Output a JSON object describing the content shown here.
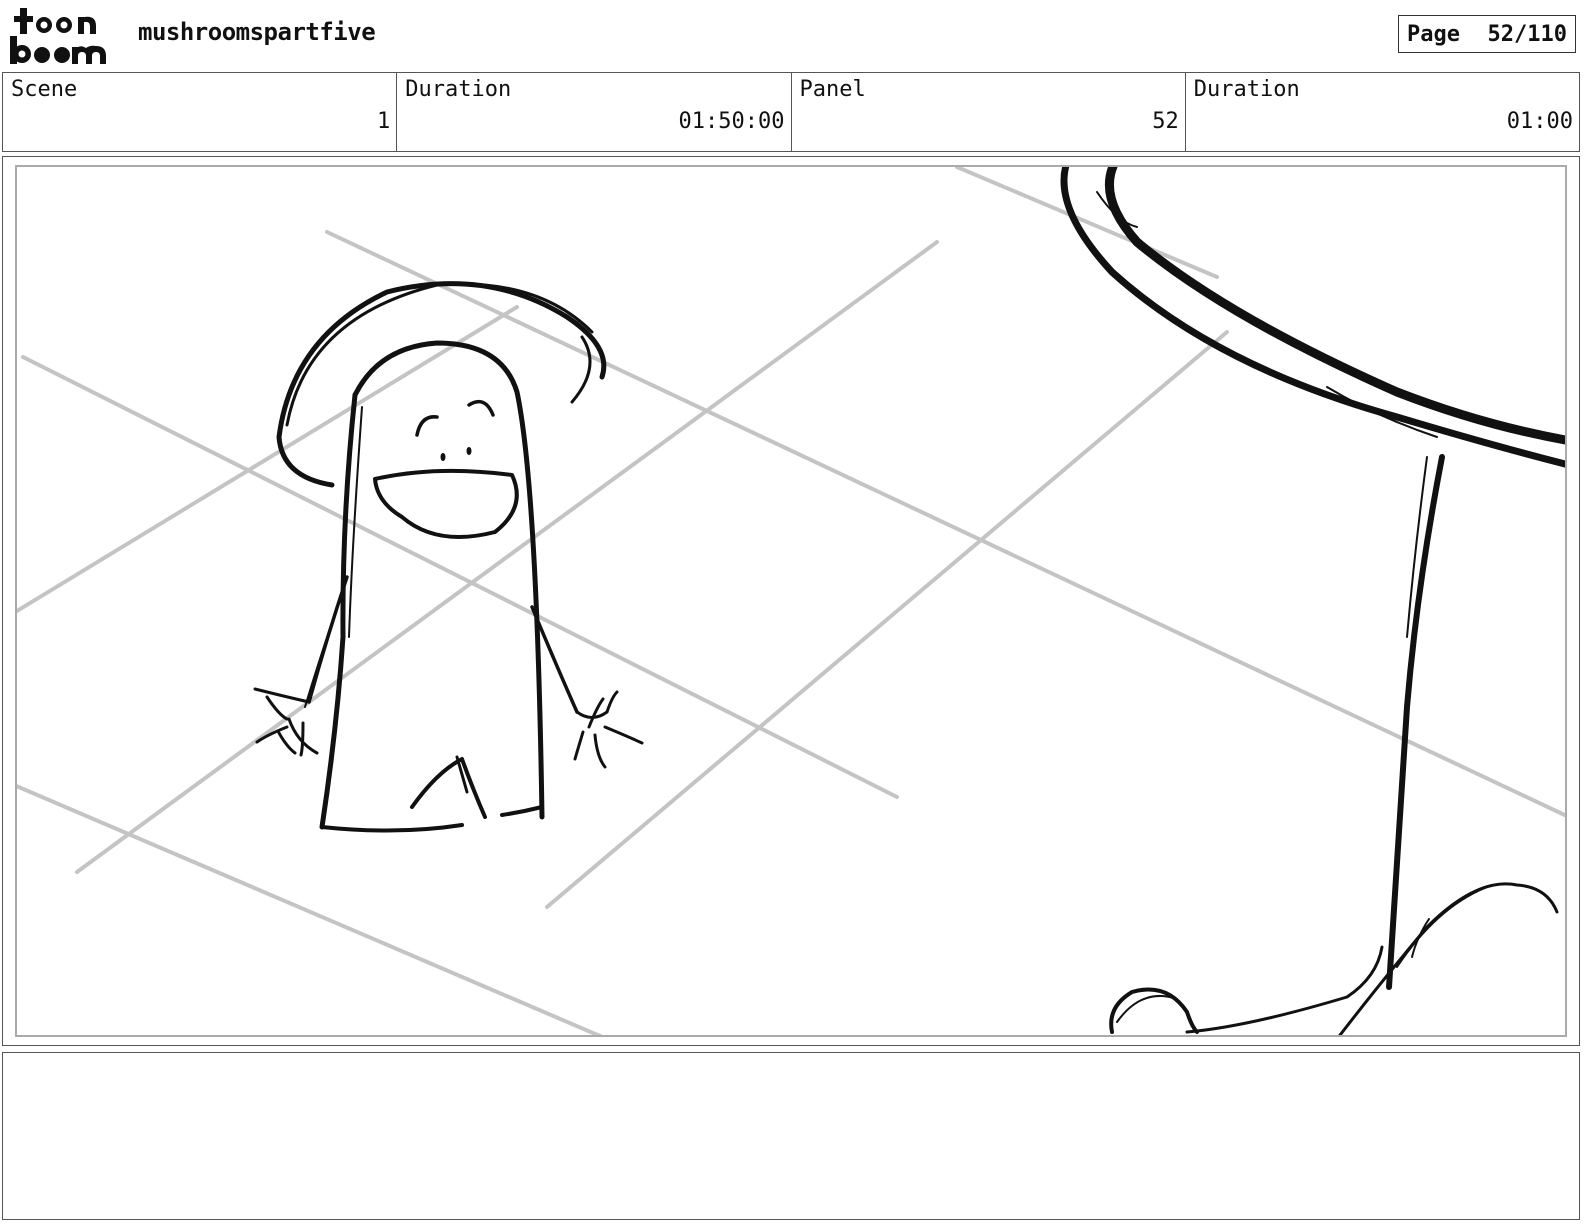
{
  "header": {
    "logo_text": "toon boom",
    "project_title": "mushroomspartfive",
    "page_label": "Page",
    "page_number": "52/110"
  },
  "info": {
    "scene_label": "Scene",
    "scene_value": "1",
    "scene_duration_label": "Duration",
    "scene_duration_value": "01:50:00",
    "panel_label": "Panel",
    "panel_value": "52",
    "panel_duration_label": "Duration",
    "panel_duration_value": "01:00"
  },
  "panel": {
    "image_description": "storyboard sketch"
  },
  "notes": {
    "text": ""
  }
}
